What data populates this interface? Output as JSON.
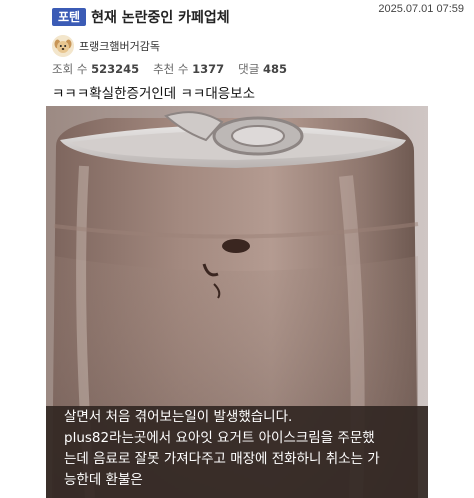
{
  "post": {
    "category_badge": "포텐",
    "title": "현재 논란중인 카페업체",
    "datetime": "2025.07.01 07:59",
    "author": "프랭크햄버거감독",
    "stats": {
      "views_label": "조회 수",
      "views": "523245",
      "likes_label": "추천 수",
      "likes": "1377",
      "comments_label": "댓글",
      "comments": "485"
    },
    "body_line": "ㅋㅋㅋ확실한증거인데 ㅋㅋ대응보소",
    "image_caption": {
      "line1": "살면서 처음 겪어보는일이 발생했습니다.",
      "line2": "plus82라는곳에서 요아잇 요거트 아이스크림을 주문했",
      "line3": "는데 음료로 잘못 가져다주고 매장에 전화하니 취소는 가",
      "line4": "능한데 환불은"
    }
  },
  "icons": {
    "avatar": "puppy-avatar-icon"
  },
  "colors": {
    "badge_bg": "#3b5bb5",
    "caption_text": "#ffffff"
  }
}
